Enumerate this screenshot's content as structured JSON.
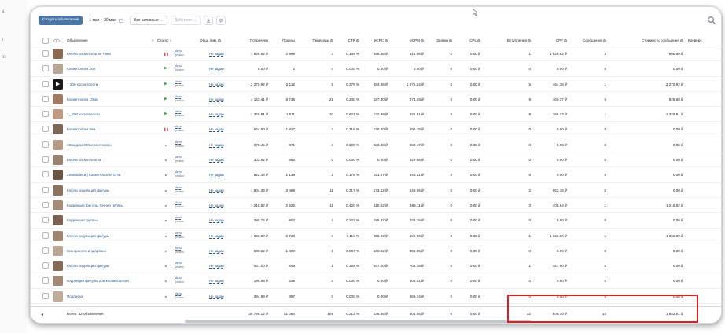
{
  "left_edge_fragments": [
    "a",
    "т",
    "ог"
  ],
  "toolbar": {
    "create_label": "Создать объявление",
    "date_range": "1 мая – 30 мая",
    "filter_label": "Все активные",
    "actions_label": "Действия"
  },
  "columns": [
    "Объявление",
    "Статус",
    "Общ. лим.",
    "Потрачено",
    "Показы",
    "Переходы",
    "CTR",
    "eCPC",
    "eCPM",
    "Заявки",
    "CPL",
    "Вступления",
    "CPF",
    "Сообщения",
    "Стоимость сообщения",
    "Конверс"
  ],
  "rows": [
    {
      "name": "Ключи косметологии +5км",
      "status": "pause",
      "mode_top": "Авто",
      "mode_bottom": "режим",
      "limit": "Не задан",
      "spent": "1 825.82 ₽",
      "shows": "2 969",
      "clicks": "4",
      "ctr": "0.135 %",
      "ecpc": "456.45 ₽",
      "ecpm": "614.96 ₽",
      "leads": "0",
      "cpl": "0.00 ₽",
      "joins": "1",
      "cpf": "1 825.82 ₽",
      "msgs": "3",
      "msg_cost": "608.60 ₽",
      "thumb": "#8a6a55"
    },
    {
      "name": "Косметологи 200",
      "status": "run",
      "mode_top": "Авто",
      "mode_bottom": "режим",
      "limit": "Не задан",
      "spent": "0.00 ₽",
      "shows": "2",
      "clicks": "0",
      "ctr": "0.000 %",
      "ecpc": "0.00 ₽",
      "ecpm": "0.00 ₽",
      "leads": "0",
      "cpl": "0.00 ₽",
      "joins": "0",
      "cpf": "0.00 ₽",
      "msgs": "0",
      "msg_cost": "0.00 ₽",
      "thumb": "#b7a695"
    },
    {
      "name": "_ 200 косметологи",
      "status": "run",
      "mode_top": "Авто",
      "mode_bottom": "режим",
      "limit": "Не задан",
      "spent": "2 270.92 ₽",
      "shows": "2 112",
      "clicks": "8",
      "ctr": "0.379 %",
      "ecpc": "283.86 ₽",
      "ecpm": "1 075.24 ₽",
      "leads": "0",
      "cpl": "0.00 ₽",
      "joins": "5",
      "cpf": "454.18 ₽",
      "msgs": "1",
      "msg_cost": "2 270.92 ₽",
      "thumb": "#1a1a1a"
    },
    {
      "name": "Косметологи 10км",
      "status": "run",
      "mode_top": "Авто",
      "mode_bottom": "режим",
      "limit": "Не задан",
      "spent": "4 143.41 ₽",
      "shows": "8 736",
      "clicks": "21",
      "ctr": "0.240 %",
      "ecpc": "197.30 ₽",
      "ecpm": "474.29 ₽",
      "leads": "0",
      "cpl": "0.00 ₽",
      "joins": "9",
      "cpf": "460.37 ₽",
      "msgs": "5",
      "msg_cost": "828.68 ₽",
      "thumb": "#a07a62"
    },
    {
      "name": "1_ 200 косметологи",
      "status": "run",
      "mode_top": "Авто",
      "mode_bottom": "режим",
      "limit": "Не задан",
      "spent": "1 329.91 ₽",
      "shows": "1 611",
      "clicks": "10",
      "ctr": "0.621 %",
      "ecpc": "132.99 ₽",
      "ecpm": "825.51 ₽",
      "leads": "0",
      "cpl": "0.00 ₽",
      "joins": "8",
      "cpf": "166.23 ₽",
      "msgs": "1",
      "msg_cost": "1 329.91 ₽",
      "thumb": "#c19a82"
    },
    {
      "name": "Косметологи 3км",
      "status": "pause",
      "mode_top": "Авто",
      "mode_bottom": "режим",
      "limit": "Не задан",
      "spent": "544.80 ₽",
      "shows": "1 827",
      "clicks": "4",
      "ctr": "0.219 %",
      "ecpc": "136.20 ₽",
      "ecpm": "298.19 ₽",
      "leads": "0",
      "cpl": "0.00 ₽",
      "joins": "0",
      "cpf": "0.00 ₽",
      "msgs": "0",
      "msg_cost": "0.00 ₽",
      "thumb": "#7d6657"
    },
    {
      "name": "10км дом 200 косметологи",
      "status": "stop",
      "mode_top": "Авто",
      "mode_bottom": "режим",
      "limit": "Не задан",
      "spent": "670.45 ₽",
      "shows": "971",
      "clicks": "3",
      "ctr": "0.309 %",
      "ecpc": "223.48 ₽",
      "ecpm": "690.47 ₽",
      "leads": "0",
      "cpl": "0.00 ₽",
      "joins": "0",
      "cpf": "0.00 ₽",
      "msgs": "0",
      "msg_cost": "0.00 ₽",
      "thumb": "#b59b88"
    },
    {
      "name": "Ключи косметологии",
      "status": "stop",
      "mode_top": "Авто",
      "mode_bottom": "режим",
      "limit": "Не задан",
      "spent": "303.62 ₽",
      "shows": "366",
      "clicks": "0",
      "ctr": "0.000 %",
      "ecpc": "0.00 ₽",
      "ecpm": "829.56 ₽",
      "leads": "0",
      "cpl": "0.00 ₽",
      "joins": "0",
      "cpf": "0.00 ₽",
      "msgs": "0",
      "msg_cost": "0.00 ₽",
      "thumb": "#9a8272"
    },
    {
      "name": "Zenmodeca | Косметология СПБ",
      "status": "stop",
      "mode_top": "Авто",
      "mode_bottom": "режим",
      "limit": "Не задан",
      "spent": "622.14 ₽",
      "shows": "1 139",
      "clicks": "2",
      "ctr": "0.176 %",
      "ecpc": "311.07 ₽",
      "ecpm": "546.21 ₽",
      "leads": "0",
      "cpl": "0.00 ₽",
      "joins": "0",
      "cpf": "0.00 ₽",
      "msgs": "0",
      "msg_cost": "0.00 ₽",
      "thumb": "#6c5646"
    },
    {
      "name": "Ключи коррекция фигуры",
      "status": "stop",
      "mode_top": "Авто",
      "mode_bottom": "режим",
      "limit": "Не задан",
      "spent": "1 904.33 ₽",
      "shows": "3 469",
      "clicks": "11",
      "ctr": "0.317 %",
      "ecpc": "173.12 ₽",
      "ecpm": "548.95 ₽",
      "leads": "0",
      "cpl": "0.00 ₽",
      "joins": "2",
      "cpf": "952.16 ₽",
      "msgs": "0",
      "msg_cost": "0.00 ₽",
      "thumb": "#8d735f"
    },
    {
      "name": "Коррекция фигуры точное группы",
      "status": "stop",
      "mode_top": "Авто",
      "mode_bottom": "режим",
      "limit": "Не задан",
      "spent": "1 216.92 ₽",
      "shows": "2 622",
      "clicks": "11",
      "ctr": "0.420 %",
      "ecpc": "110.62 ₽",
      "ecpm": "464.11 ₽",
      "leads": "0",
      "cpl": "0.00 ₽",
      "joins": "3",
      "cpf": "405.64 ₽",
      "msgs": "1",
      "msg_cost": "1 216.92 ₽",
      "thumb": "#a38b78"
    },
    {
      "name": "Коррекция группы",
      "status": "stop",
      "mode_top": "Авто",
      "mode_bottom": "режим",
      "limit": "Не задан",
      "spent": "390.74 ₽",
      "shows": "902",
      "clicks": "2",
      "ctr": "0.222 %",
      "ecpc": "195.37 ₽",
      "ecpm": "433.19 ₽",
      "leads": "0",
      "cpl": "0.00 ₽",
      "joins": "0",
      "cpf": "0.00 ₽",
      "msgs": "0",
      "msg_cost": "0.00 ₽",
      "thumb": "#7a6150"
    },
    {
      "name": "Ключи коррекция фигуры",
      "status": "stop",
      "mode_top": "Авто",
      "mode_bottom": "режим",
      "limit": "Не задан",
      "spent": "1 366.90 ₽",
      "shows": "2 728",
      "clicks": "3",
      "ctr": "0.110 %",
      "ecpc": "455.63 ₽",
      "ecpm": "502.53 ₽",
      "leads": "0",
      "cpl": "0.00 ₽",
      "joins": "1",
      "cpf": "1 366.90 ₽",
      "msgs": "1",
      "msg_cost": "1 366.90 ₽",
      "thumb": "#9d8571"
    },
    {
      "name": "5км красота и здоровье",
      "status": "stop",
      "mode_top": "Авто",
      "mode_bottom": "режим",
      "limit": "Не задан",
      "spent": "530.22 ₽",
      "shows": "1 490",
      "clicks": "1",
      "ctr": "0.067 %",
      "ecpc": "530.22 ₽",
      "ecpm": "355.85 ₽",
      "leads": "0",
      "cpl": "0.00 ₽",
      "joins": "0",
      "cpf": "0.00 ₽",
      "msgs": "0",
      "msg_cost": "0.00 ₽",
      "thumb": "#b9a594"
    },
    {
      "name": "Ключи коррекция фигуры",
      "status": "stop",
      "mode_top": "Авто",
      "mode_bottom": "режим",
      "limit": "Не задан",
      "spent": "457.00 ₽",
      "shows": "649",
      "clicks": "1",
      "ctr": "0.154 %",
      "ecpc": "457.00 ₽",
      "ecpm": "704.16 ₽",
      "leads": "0",
      "cpl": "0.00 ₽",
      "joins": "1",
      "cpf": "457.00 ₽",
      "msgs": "0",
      "msg_cost": "0.00 ₽",
      "thumb": "#846a58"
    },
    {
      "name": "коррекция фигуры 200 косметологии",
      "status": "stop",
      "mode_top": "Авто",
      "mode_bottom": "режим",
      "limit": "Не задан",
      "spent": "199.95 ₽",
      "shows": "249",
      "clicks": "0",
      "ctr": "0.000 %",
      "ecpc": "0.00 ₽",
      "ecpm": "803.01 ₽",
      "leads": "0",
      "cpl": "0.00 ₽",
      "joins": "0",
      "cpf": "0.00 ₽",
      "msgs": "0",
      "msg_cost": "0.00 ₽",
      "thumb": "#a18976"
    },
    {
      "name": "Подписка",
      "status": "stop",
      "mode_top": "Авто",
      "mode_bottom": "режим",
      "limit": "Не задан",
      "spent": "384.99 ₽",
      "shows": "397",
      "clicks": "0",
      "ctr": "0.000 %",
      "ecpc": "0.00 ₽",
      "ecpm": "969.74 ₽",
      "leads": "0",
      "cpl": "0.00 ₽",
      "joins": "0",
      "cpf": "0.00 ₽",
      "msgs": "0",
      "msg_cost": "0.00 ₽",
      "thumb": "#c0ab99"
    }
  ],
  "totals": {
    "label": "Всего: 52 объявления",
    "spent": "25 795.12 ₽",
    "shows": "51 084",
    "clicks": "109",
    "ctr": "0.213 %",
    "ecpc": "236.65 ₽",
    "ecpm": "504.95 ₽",
    "leads": "0",
    "cpl": "0.00 ₽",
    "joins": "32",
    "cpf": "806.10 ₽",
    "msgs": "14",
    "msg_cost": "1 842.51 ₽"
  },
  "colors": {
    "accent": "#4a76a8",
    "link": "#2a5885",
    "run": "#4bb34b",
    "pause": "#e64646",
    "highlight": "#e02020"
  }
}
